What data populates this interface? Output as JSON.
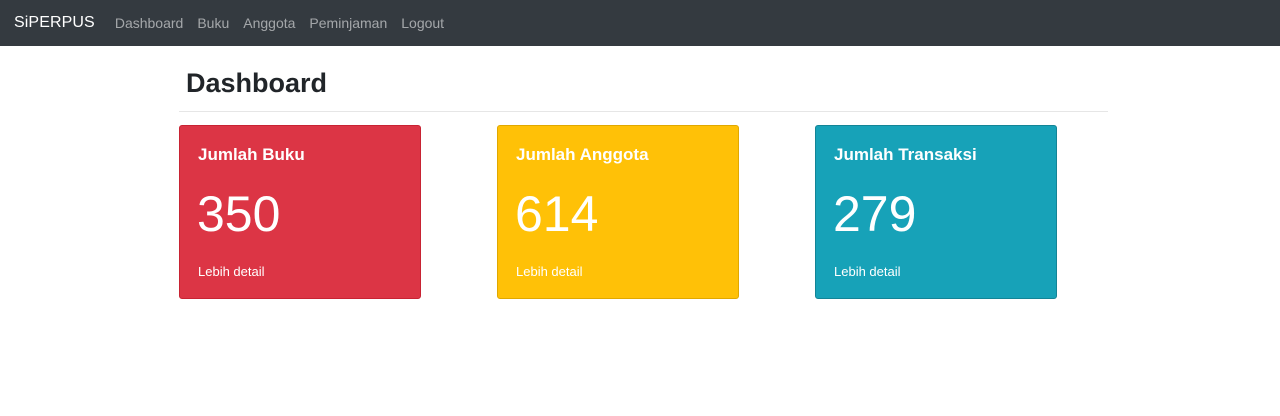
{
  "navbar": {
    "brand": "SiPERPUS",
    "links": [
      "Dashboard",
      "Buku",
      "Anggota",
      "Peminjaman",
      "Logout"
    ]
  },
  "page": {
    "title": "Dashboard"
  },
  "cards": [
    {
      "title": "Jumlah Buku",
      "value": "350",
      "link": "Lebih detail",
      "color": "#dc3545"
    },
    {
      "title": "Jumlah Anggota",
      "value": "614",
      "link": "Lebih detail",
      "color": "#ffc107"
    },
    {
      "title": "Jumlah Transaksi",
      "value": "279",
      "link": "Lebih detail",
      "color": "#17a2b8"
    }
  ]
}
